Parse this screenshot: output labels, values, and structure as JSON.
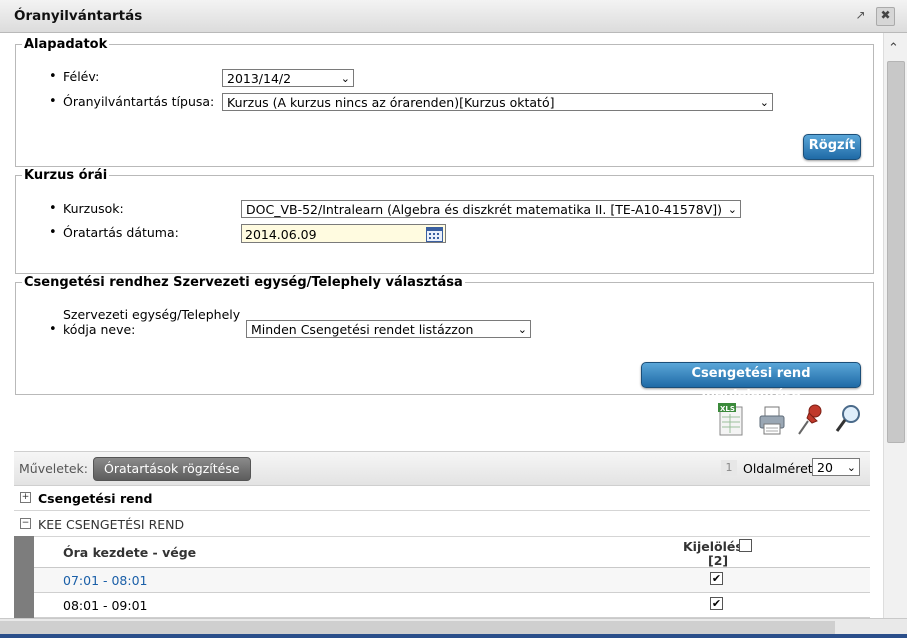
{
  "window": {
    "title": "Óranyilvántartás"
  },
  "alapadatok": {
    "legend": "Alapadatok",
    "felev_label": "Félév:",
    "felev_value": "2013/14/2",
    "tipus_label": "Óranyilvántartás típusa:",
    "tipus_value": "Kurzus (A kurzus nincs az órarenden)[Kurzus oktató]",
    "rogzit_label": "Rögzít"
  },
  "kurzus_orai": {
    "legend": "Kurzus órái",
    "kurzusok_label": "Kurzusok:",
    "kurzusok_value": "DOC_VB-52/Intralearn (Algebra és diszkrét matematika II. [TE-A10-41578V])",
    "datum_label": "Óratartás dátuma:",
    "datum_value": "2014.06.09"
  },
  "csengetesi": {
    "legend": "Csengetési rendhez Szervezeti egység/Telephely választása",
    "label_line1": "Szervezeti egység/Telephely",
    "label_line2": "kódja neve:",
    "select_value": "Minden Csengetési rendet listázzon",
    "button_label": "Csengetési rend megjelentése"
  },
  "toolbar": {
    "icons": [
      "xls-export-icon",
      "print-icon",
      "pin-icon",
      "search-icon"
    ],
    "xls_text": "XLS"
  },
  "grid": {
    "muveletek_label": "Műveletek:",
    "action_button": "Óratartások rögzítése",
    "page_number": "1",
    "page_size_label": "Oldalméret",
    "page_size_value": "20",
    "groups": [
      {
        "label": "Csengetési rend",
        "state": "collapsed"
      },
      {
        "label": "KEE CSENGETÉSI REND",
        "state": "expanded"
      }
    ],
    "column_header": "Óra kezdete - vége",
    "select_header": "Kijelölés",
    "select_count": "[2]",
    "rows": [
      {
        "time": "07:01 - 08:01",
        "checked": true
      },
      {
        "time": "08:01 - 09:01",
        "checked": true
      }
    ]
  },
  "colors": {
    "link": "#1a5fa8",
    "button_blue": "#1f6aa6"
  }
}
